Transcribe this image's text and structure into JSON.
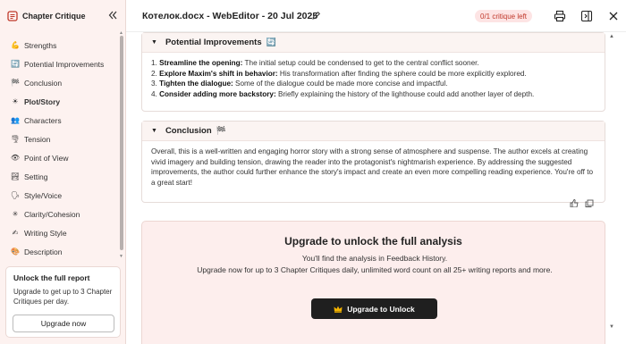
{
  "sidebar": {
    "title": "Chapter Critique",
    "items": [
      {
        "label": "Strengths",
        "icon": "muscle-icon",
        "glyph": "💪"
      },
      {
        "label": "Potential Improvements",
        "icon": "arrows-icon",
        "glyph": "🔄"
      },
      {
        "label": "Conclusion",
        "icon": "checkered-flag-icon",
        "glyph": "🏁"
      },
      {
        "label": "Plot/Story",
        "icon": "sun-icon",
        "glyph": "☀"
      },
      {
        "label": "Characters",
        "icon": "people-icon",
        "glyph": "👥"
      },
      {
        "label": "Tension",
        "icon": "tornado-icon",
        "glyph": "🌪"
      },
      {
        "label": "Point of View",
        "icon": "eye-icon",
        "glyph": "👁"
      },
      {
        "label": "Setting",
        "icon": "landscape-icon",
        "glyph": "🏞"
      },
      {
        "label": "Style/Voice",
        "icon": "speech-icon",
        "glyph": "🗣"
      },
      {
        "label": "Clarity/Cohesion",
        "icon": "sparkle-icon",
        "glyph": "✳"
      },
      {
        "label": "Writing Style",
        "icon": "writing-hand-icon",
        "glyph": "✍"
      },
      {
        "label": "Description",
        "icon": "palette-icon",
        "glyph": "🎨"
      }
    ],
    "active_index": 3,
    "upgrade": {
      "title": "Unlock the full report",
      "text": "Upgrade to get up to 3 Chapter Critiques per day.",
      "button": "Upgrade now"
    }
  },
  "header": {
    "doc_title": "Котелок.docx - WebEditor - 20 Jul 2025",
    "critique_badge": "0/1 critique left"
  },
  "improvements": {
    "title": "Potential Improvements",
    "emoji": "🔄",
    "items": [
      {
        "num": "1.",
        "bold": "Streamline the opening:",
        "text": " The initial setup could be condensed to get to the central conflict sooner."
      },
      {
        "num": "2.",
        "bold": "Explore Maxim's shift in behavior:",
        "text": " His transformation after finding the sphere could be more explicitly explored."
      },
      {
        "num": "3.",
        "bold": "Tighten the dialogue:",
        "text": " Some of the dialogue could be made more concise and impactful."
      },
      {
        "num": "4.",
        "bold": "Consider adding more backstory:",
        "text": " Briefly explaining the history of the lighthouse could add another layer of depth."
      }
    ]
  },
  "conclusion": {
    "title": "Conclusion",
    "emoji": "🏁",
    "text": "Overall, this is a well-written and engaging horror story with a strong sense of atmosphere and suspense. The author excels at creating vivid imagery and building tension, drawing the reader into the protagonist's nightmarish experience. By addressing the suggested improvements, the author could further enhance the story's impact and create an even more compelling reading experience. You're off to a great start!"
  },
  "unlock": {
    "title": "Upgrade to unlock the full analysis",
    "line1": "You'll find the analysis in Feedback History.",
    "line2": "Upgrade now for up to 3 Chapter Critiques daily, unlimited word count on all 25+ writing reports and more.",
    "button": "Upgrade to Unlock",
    "button_icon": "crown-icon"
  },
  "colors": {
    "sidebar_bg": "#fdf2f0",
    "badge_text": "#c0392b",
    "badge_bg": "#fde4e4",
    "unlock_bg": "#fdeeed",
    "button_dark": "#1f1f1f",
    "crown": "#f5b400"
  }
}
